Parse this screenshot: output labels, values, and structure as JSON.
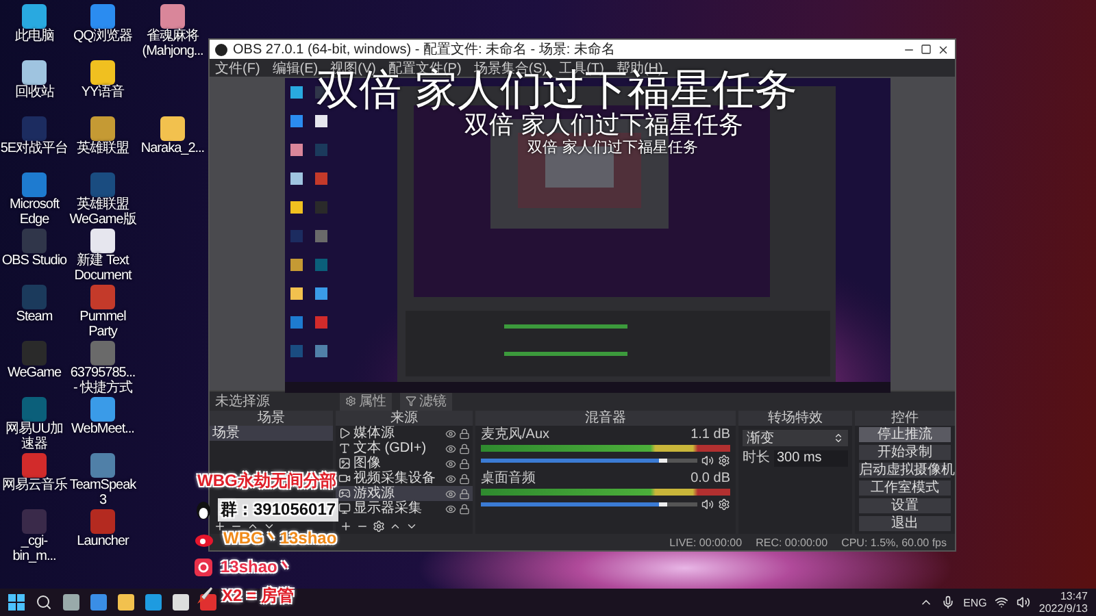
{
  "desktop": {
    "rows": [
      {
        "icons": [
          "此电脑",
          "QQ浏览器",
          "雀魂麻将 (Mahjong..."
        ]
      },
      {
        "icons": [
          "回收站",
          "YY语音"
        ]
      },
      {
        "icons": [
          "5E对战平台",
          "英雄联盟",
          "Naraka_2..."
        ]
      },
      {
        "icons": [
          "Microsoft Edge",
          "英雄联盟 WeGame版"
        ]
      },
      {
        "icons": [
          "OBS Studio",
          "新建 Text Document"
        ]
      },
      {
        "icons": [
          "Steam",
          "Pummel Party"
        ]
      },
      {
        "icons": [
          "WeGame",
          "63795785... - 快捷方式"
        ]
      },
      {
        "icons": [
          "网易UU加速器",
          "WebMeet..."
        ]
      },
      {
        "icons": [
          "网易云音乐",
          "TeamSpeak 3"
        ]
      },
      {
        "icons": [
          "_cgi-bin_m...",
          "Launcher"
        ]
      }
    ]
  },
  "window": {
    "title": "OBS 27.0.1 (64-bit, windows) - 配置文件: 未命名 - 场景: 未命名",
    "menu": [
      "文件(F)",
      "编辑(E)",
      "视图(V)",
      "配置文件(P)",
      "场景集合(S)",
      "工具(T)",
      "帮助(H)"
    ]
  },
  "preview": {
    "captions": [
      "双倍 家人们过下福星任务",
      "双倍 家人们过下福星任务",
      "双倍 家人们过下福星任务"
    ]
  },
  "source_toolbar": {
    "label": "未选择源",
    "buttons": [
      {
        "label": "属性",
        "kind": "gear"
      },
      {
        "label": "滤镜",
        "kind": "filter"
      }
    ]
  },
  "scenes": {
    "title": "场景",
    "items": [
      {
        "label": "场景",
        "selected": true
      }
    ]
  },
  "sources": {
    "title": "来源",
    "items": [
      {
        "label": "媒体源",
        "kind": "media",
        "selected": false
      },
      {
        "label": "文本 (GDI+)",
        "kind": "text",
        "selected": false
      },
      {
        "label": "图像",
        "kind": "image",
        "selected": false
      },
      {
        "label": "视频采集设备",
        "kind": "camera",
        "selected": false
      },
      {
        "label": "游戏源",
        "kind": "game",
        "selected": true
      },
      {
        "label": "显示器采集",
        "kind": "display",
        "selected": false
      }
    ]
  },
  "mixer": {
    "title": "混音器",
    "channels": [
      {
        "name": "麦克风/Aux",
        "reading": "1.1 dB",
        "level": 0.86
      },
      {
        "name": "桌面音频",
        "reading": "0.0 dB",
        "level": 0.86
      }
    ]
  },
  "transitions": {
    "title": "转场特效",
    "type": "渐变",
    "duration_label": "时长",
    "duration": "300 ms"
  },
  "controls": {
    "title": "控件",
    "buttons": [
      {
        "label": "停止推流",
        "active": true
      },
      {
        "label": "开始录制",
        "active": false
      },
      {
        "label": "启动虚拟摄像机",
        "active": false
      },
      {
        "label": "工作室模式",
        "active": false
      },
      {
        "label": "设置",
        "active": false
      },
      {
        "label": "退出",
        "active": false
      }
    ]
  },
  "status_bar": {
    "live": "LIVE: 00:00:00",
    "rec": "REC: 00:00:00",
    "cpu": "CPU: 1.5%, 60.00 fps"
  },
  "overlay": {
    "lines": [
      {
        "kind": "title",
        "text": "WBG永劫无间分部"
      },
      {
        "kind": "qq",
        "text": "群：391056017"
      },
      {
        "kind": "weibo",
        "text": "WBG丶13shao"
      },
      {
        "kind": "app",
        "text": "13shao丶"
      },
      {
        "kind": "rocket",
        "text": "X2 = 房管"
      }
    ]
  },
  "taskbar": {
    "language": "ENG",
    "time": "13:47",
    "date": "2022/9/13"
  }
}
